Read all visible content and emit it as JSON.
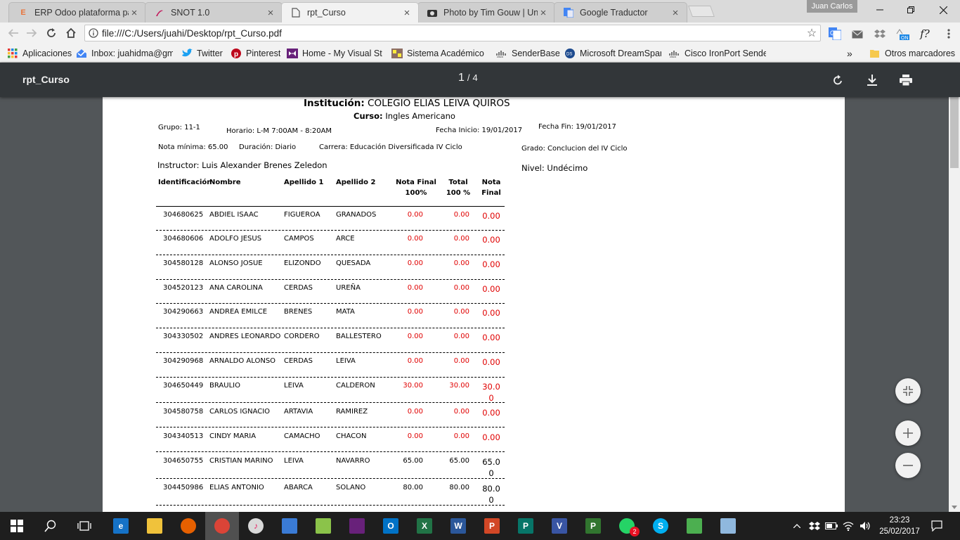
{
  "browser": {
    "tabs": [
      {
        "title": "ERP Odoo plataforma pa",
        "icon": "odoo-icon",
        "color": "#e8743b"
      },
      {
        "title": "SNOT 1.0",
        "icon": "snot-icon",
        "color": "#c2185b"
      },
      {
        "title": "rpt_Curso",
        "icon": "document-icon",
        "color": "#555555",
        "active": true
      },
      {
        "title": "Photo by Tim Gouw | Un",
        "icon": "camera-icon",
        "color": "#333333"
      },
      {
        "title": "Google Traductor",
        "icon": "translate-icon",
        "color": "#4285f4"
      }
    ],
    "user": "Juan Carlos",
    "url": "file:///C:/Users/juahi/Desktop/rpt_Curso.pdf",
    "bookmarks": [
      {
        "label": "Aplicaciones",
        "icon": "apps-grid-icon"
      },
      {
        "label": "Inbox: juahidma@gm",
        "icon": "inbox-icon"
      },
      {
        "label": "Twitter",
        "icon": "twitter-icon"
      },
      {
        "label": "Pinterest",
        "icon": "pinterest-icon"
      },
      {
        "label": "Home - My Visual Stu",
        "icon": "visual-studio-icon"
      },
      {
        "label": "Sistema Académico U",
        "icon": "academic-icon"
      },
      {
        "label": "SenderBase",
        "icon": "cisco-icon"
      },
      {
        "label": "Microsoft DreamSpar",
        "icon": "dreamspark-icon"
      },
      {
        "label": "Cisco IronPort Sender",
        "icon": "cisco-icon"
      }
    ],
    "bookmarks_more": "»",
    "other_bookmarks": "Otros marcadores"
  },
  "pdf": {
    "title": "rpt_Curso",
    "current_page": "1",
    "page_sep": "/",
    "total_pages": "4"
  },
  "report": {
    "institution_label": "Institución:",
    "institution": "COLEGIO ELIAS LEIVA QUIROS",
    "course_label": "Curso:",
    "course": "Ingles Americano",
    "group": "Grupo: 11-1",
    "schedule": "Horario: L-M  7:00AM - 8:20AM",
    "start_date": "Fecha Inicio: 19/01/2017",
    "end_date": "Fecha Fin: 19/01/2017",
    "min_grade": "Nota mínima: 65.00",
    "duration": "Duración: Diario",
    "career": "Carrera: Educación Diversificada IV Ciclo",
    "degree": "Grado: Conclucion del IV Ciclo",
    "instructor": "Instructor: Luis Alexander Brenes Zeledon",
    "level": "Nivel: Undécimo",
    "columns": {
      "id": "Identificación",
      "name": "Nombre",
      "surname1": "Apellido 1",
      "surname2": "Apellido 2",
      "final100_a": "Nota Final",
      "final100_b": "100%",
      "total_a": "Total",
      "total_b": "100 %",
      "final_a": "Nota",
      "final_b": "Final"
    },
    "rows": [
      {
        "id": "304680625",
        "name": "ABDIEL ISAAC",
        "s1": "FIGUEROA",
        "s2": "GRANADOS",
        "nf": "0.00",
        "total": "0.00",
        "final": "0.00",
        "red": true
      },
      {
        "id": "304680606",
        "name": "ADOLFO JESUS",
        "s1": "CAMPOS",
        "s2": "ARCE",
        "nf": "0.00",
        "total": "0.00",
        "final": "0.00",
        "red": true
      },
      {
        "id": "304580128",
        "name": "ALONSO JOSUE",
        "s1": "ELIZONDO",
        "s2": "QUESADA",
        "nf": "0.00",
        "total": "0.00",
        "final": "0.00",
        "red": true
      },
      {
        "id": "304520123",
        "name": "ANA CAROLINA",
        "s1": "CERDAS",
        "s2": "UREÑA",
        "nf": "0.00",
        "total": "0.00",
        "final": "0.00",
        "red": true
      },
      {
        "id": "304290663",
        "name": "ANDREA EMILCE",
        "s1": "BRENES",
        "s2": "MATA",
        "nf": "0.00",
        "total": "0.00",
        "final": "0.00",
        "red": true
      },
      {
        "id": "304330502",
        "name": "ANDRES LEONARDO",
        "s1": "CORDERO",
        "s2": "BALLESTERO",
        "nf": "0.00",
        "total": "0.00",
        "final": "0.00",
        "red": true
      },
      {
        "id": "304290968",
        "name": "ARNALDO ALONSO",
        "s1": "CERDAS",
        "s2": "LEIVA",
        "nf": "0.00",
        "total": "0.00",
        "final": "0.00",
        "red": true
      },
      {
        "id": "304650449",
        "name": "BRAULIO",
        "s1": "LEIVA",
        "s2": "CALDERON",
        "nf": "30.00",
        "total": "30.00",
        "final": "30.00",
        "red": true
      },
      {
        "id": "304580758",
        "name": "CARLOS IGNACIO",
        "s1": "ARTAVIA",
        "s2": "RAMIREZ",
        "nf": "0.00",
        "total": "0.00",
        "final": "0.00",
        "red": true
      },
      {
        "id": "304340513",
        "name": "CINDY MARIA",
        "s1": "CAMACHO",
        "s2": "CHACON",
        "nf": "0.00",
        "total": "0.00",
        "final": "0.00",
        "red": true
      },
      {
        "id": "304650755",
        "name": "CRISTIAN MARINO",
        "s1": "LEIVA",
        "s2": "NAVARRO",
        "nf": "65.00",
        "total": "65.00",
        "final": "65.00",
        "red": false
      },
      {
        "id": "304450986",
        "name": "ELIAS ANTONIO",
        "s1": "ABARCA",
        "s2": "SOLANO",
        "nf": "80.00",
        "total": "80.00",
        "final": "80.00",
        "red": false
      }
    ]
  },
  "taskbar": {
    "apps": [
      {
        "name": "edge-icon",
        "color": "#1572c7",
        "glyph": "e"
      },
      {
        "name": "file-explorer-icon",
        "color": "#f0c23b",
        "glyph": ""
      },
      {
        "name": "firefox-icon",
        "color": "#e66000",
        "glyph": ""
      },
      {
        "name": "chrome-icon",
        "color": "#db4437",
        "glyph": "",
        "active": true
      },
      {
        "name": "itunes-icon",
        "color": "#d9d9d9",
        "glyph": "♪"
      },
      {
        "name": "network-tool-icon",
        "color": "#3a7bd5",
        "glyph": ""
      },
      {
        "name": "tools-icon",
        "color": "#8bc34a",
        "glyph": ""
      },
      {
        "name": "visual-studio-taskbar-icon",
        "color": "#68217a",
        "glyph": ""
      },
      {
        "name": "outlook-icon",
        "color": "#0072c6",
        "glyph": "O"
      },
      {
        "name": "excel-icon",
        "color": "#217346",
        "glyph": "X"
      },
      {
        "name": "word-icon",
        "color": "#2b579a",
        "glyph": "W"
      },
      {
        "name": "powerpoint-icon",
        "color": "#d24726",
        "glyph": "P"
      },
      {
        "name": "publisher-icon",
        "color": "#077568",
        "glyph": "P"
      },
      {
        "name": "visio-icon",
        "color": "#3955a3",
        "glyph": "V"
      },
      {
        "name": "project-icon",
        "color": "#31752f",
        "glyph": "P"
      },
      {
        "name": "whatsapp-icon",
        "color": "#25d366",
        "glyph": "",
        "badge": "2"
      },
      {
        "name": "skype-icon",
        "color": "#00aff0",
        "glyph": "S"
      },
      {
        "name": "chart-app-icon",
        "color": "#4caf50",
        "glyph": ""
      },
      {
        "name": "notes-app-icon",
        "color": "#8fb8de",
        "glyph": ""
      }
    ],
    "time": "23:23",
    "date": "25/02/2017"
  }
}
